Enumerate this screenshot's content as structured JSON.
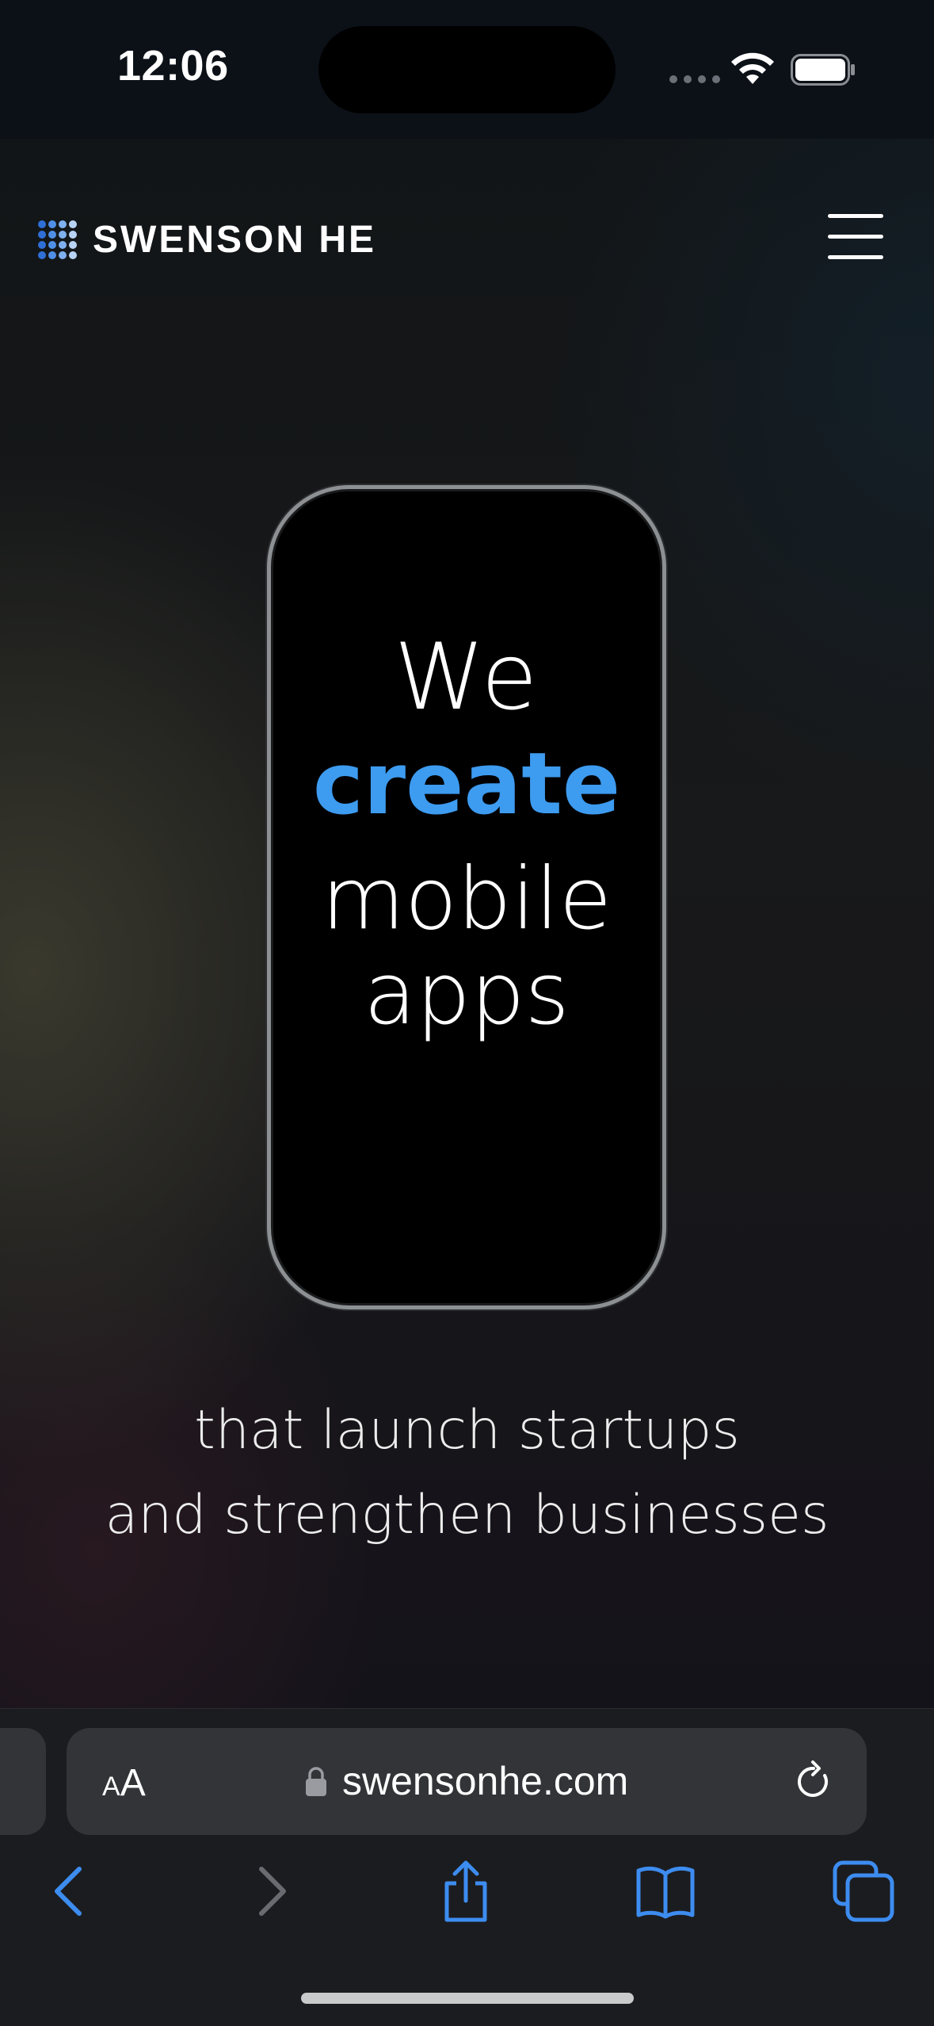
{
  "status_bar": {
    "time": "12:06"
  },
  "site": {
    "logo_text": "SWENSON HE",
    "logo_dot_colors": [
      "#2f6fd6",
      "#4f8fe6",
      "#7fb0ef",
      "#b9d3f5"
    ]
  },
  "hero": {
    "line_we": "We",
    "line_create": "create",
    "line_mobile": "mobile",
    "line_apps": "apps",
    "accent_color": "#3d9bf0"
  },
  "tagline": {
    "line1": "that launch startups",
    "line2": "and strengthen businesses"
  },
  "browser": {
    "aa_small": "A",
    "aa_large": "A",
    "url": "swensonhe.com",
    "icons": [
      "back-icon",
      "forward-icon",
      "share-icon",
      "bookmarks-icon",
      "tabs-icon"
    ],
    "icon_active_color": "#3d8cf0",
    "icon_disabled_color": "#6a6b70"
  }
}
